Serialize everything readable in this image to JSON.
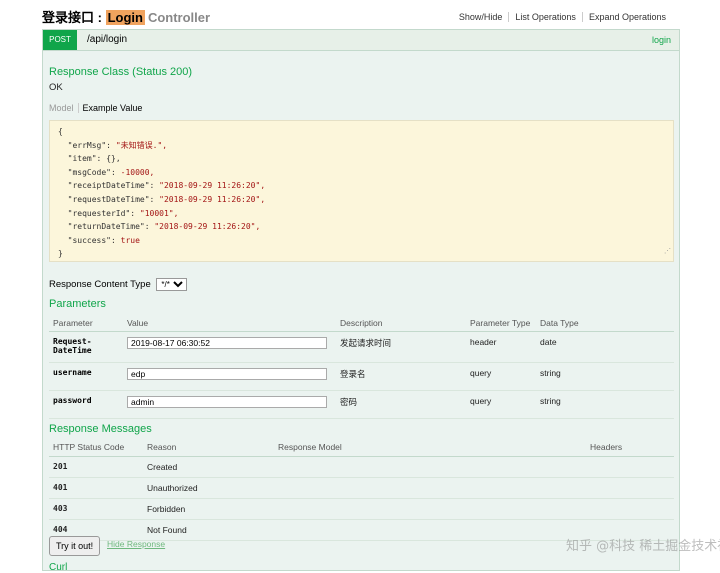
{
  "header": {
    "title_prefix": "登录接口 : ",
    "title_highlight": "Login",
    "title_suffix": "Controller",
    "ops": [
      "Show/Hide",
      "List Operations",
      "Expand Operations"
    ]
  },
  "operation": {
    "method": "POST",
    "path": "/api/login",
    "link": "login"
  },
  "response_class": {
    "heading": "Response Class (Status 200)",
    "text": "OK",
    "tab_model": "Model",
    "tab_example": "Example Value"
  },
  "example_json": {
    "open": "{",
    "lines": [
      {
        "key": "\"errMsg\"",
        "val": "\"未知错误.\","
      },
      {
        "key": "\"item\"",
        "val": "{},"
      },
      {
        "key": "\"msgCode\"",
        "val": "-10000,"
      },
      {
        "key": "\"receiptDateTime\"",
        "val": "\"2018-09-29 11:26:20\","
      },
      {
        "key": "\"requestDateTime\"",
        "val": "\"2018-09-29 11:26:20\","
      },
      {
        "key": "\"requesterId\"",
        "val": "\"10001\","
      },
      {
        "key": "\"returnDateTime\"",
        "val": "\"2018-09-29 11:26:20\","
      },
      {
        "key": "\"success\"",
        "val": "true"
      }
    ],
    "close": "}"
  },
  "content_type": {
    "label": "Response Content Type",
    "selected": "*/*"
  },
  "parameters": {
    "heading": "Parameters",
    "columns": [
      "Parameter",
      "Value",
      "Description",
      "Parameter Type",
      "Data Type"
    ],
    "rows": [
      {
        "name_l1": "Request-",
        "name_l2": "DateTime",
        "value": "2019-08-17 06:30:52",
        "description": "发起请求时间",
        "ptype": "header",
        "dtype": "date"
      },
      {
        "name_l1": "username",
        "name_l2": "",
        "value": "edp",
        "description": "登录名",
        "ptype": "query",
        "dtype": "string"
      },
      {
        "name_l1": "password",
        "name_l2": "",
        "value": "admin",
        "description": "密码",
        "ptype": "query",
        "dtype": "string"
      }
    ]
  },
  "response_messages": {
    "heading": "Response Messages",
    "columns": [
      "HTTP Status Code",
      "Reason",
      "Response Model",
      "Headers"
    ],
    "rows": [
      {
        "code": "201",
        "reason": "Created"
      },
      {
        "code": "401",
        "reason": "Unauthorized"
      },
      {
        "code": "403",
        "reason": "Forbidden"
      },
      {
        "code": "404",
        "reason": "Not Found"
      }
    ]
  },
  "actions": {
    "try": "Try it out!",
    "hide": "Hide Response",
    "cut_heading": "Curl"
  },
  "watermark": "知乎 @科技 稀土掘金技术社区"
}
